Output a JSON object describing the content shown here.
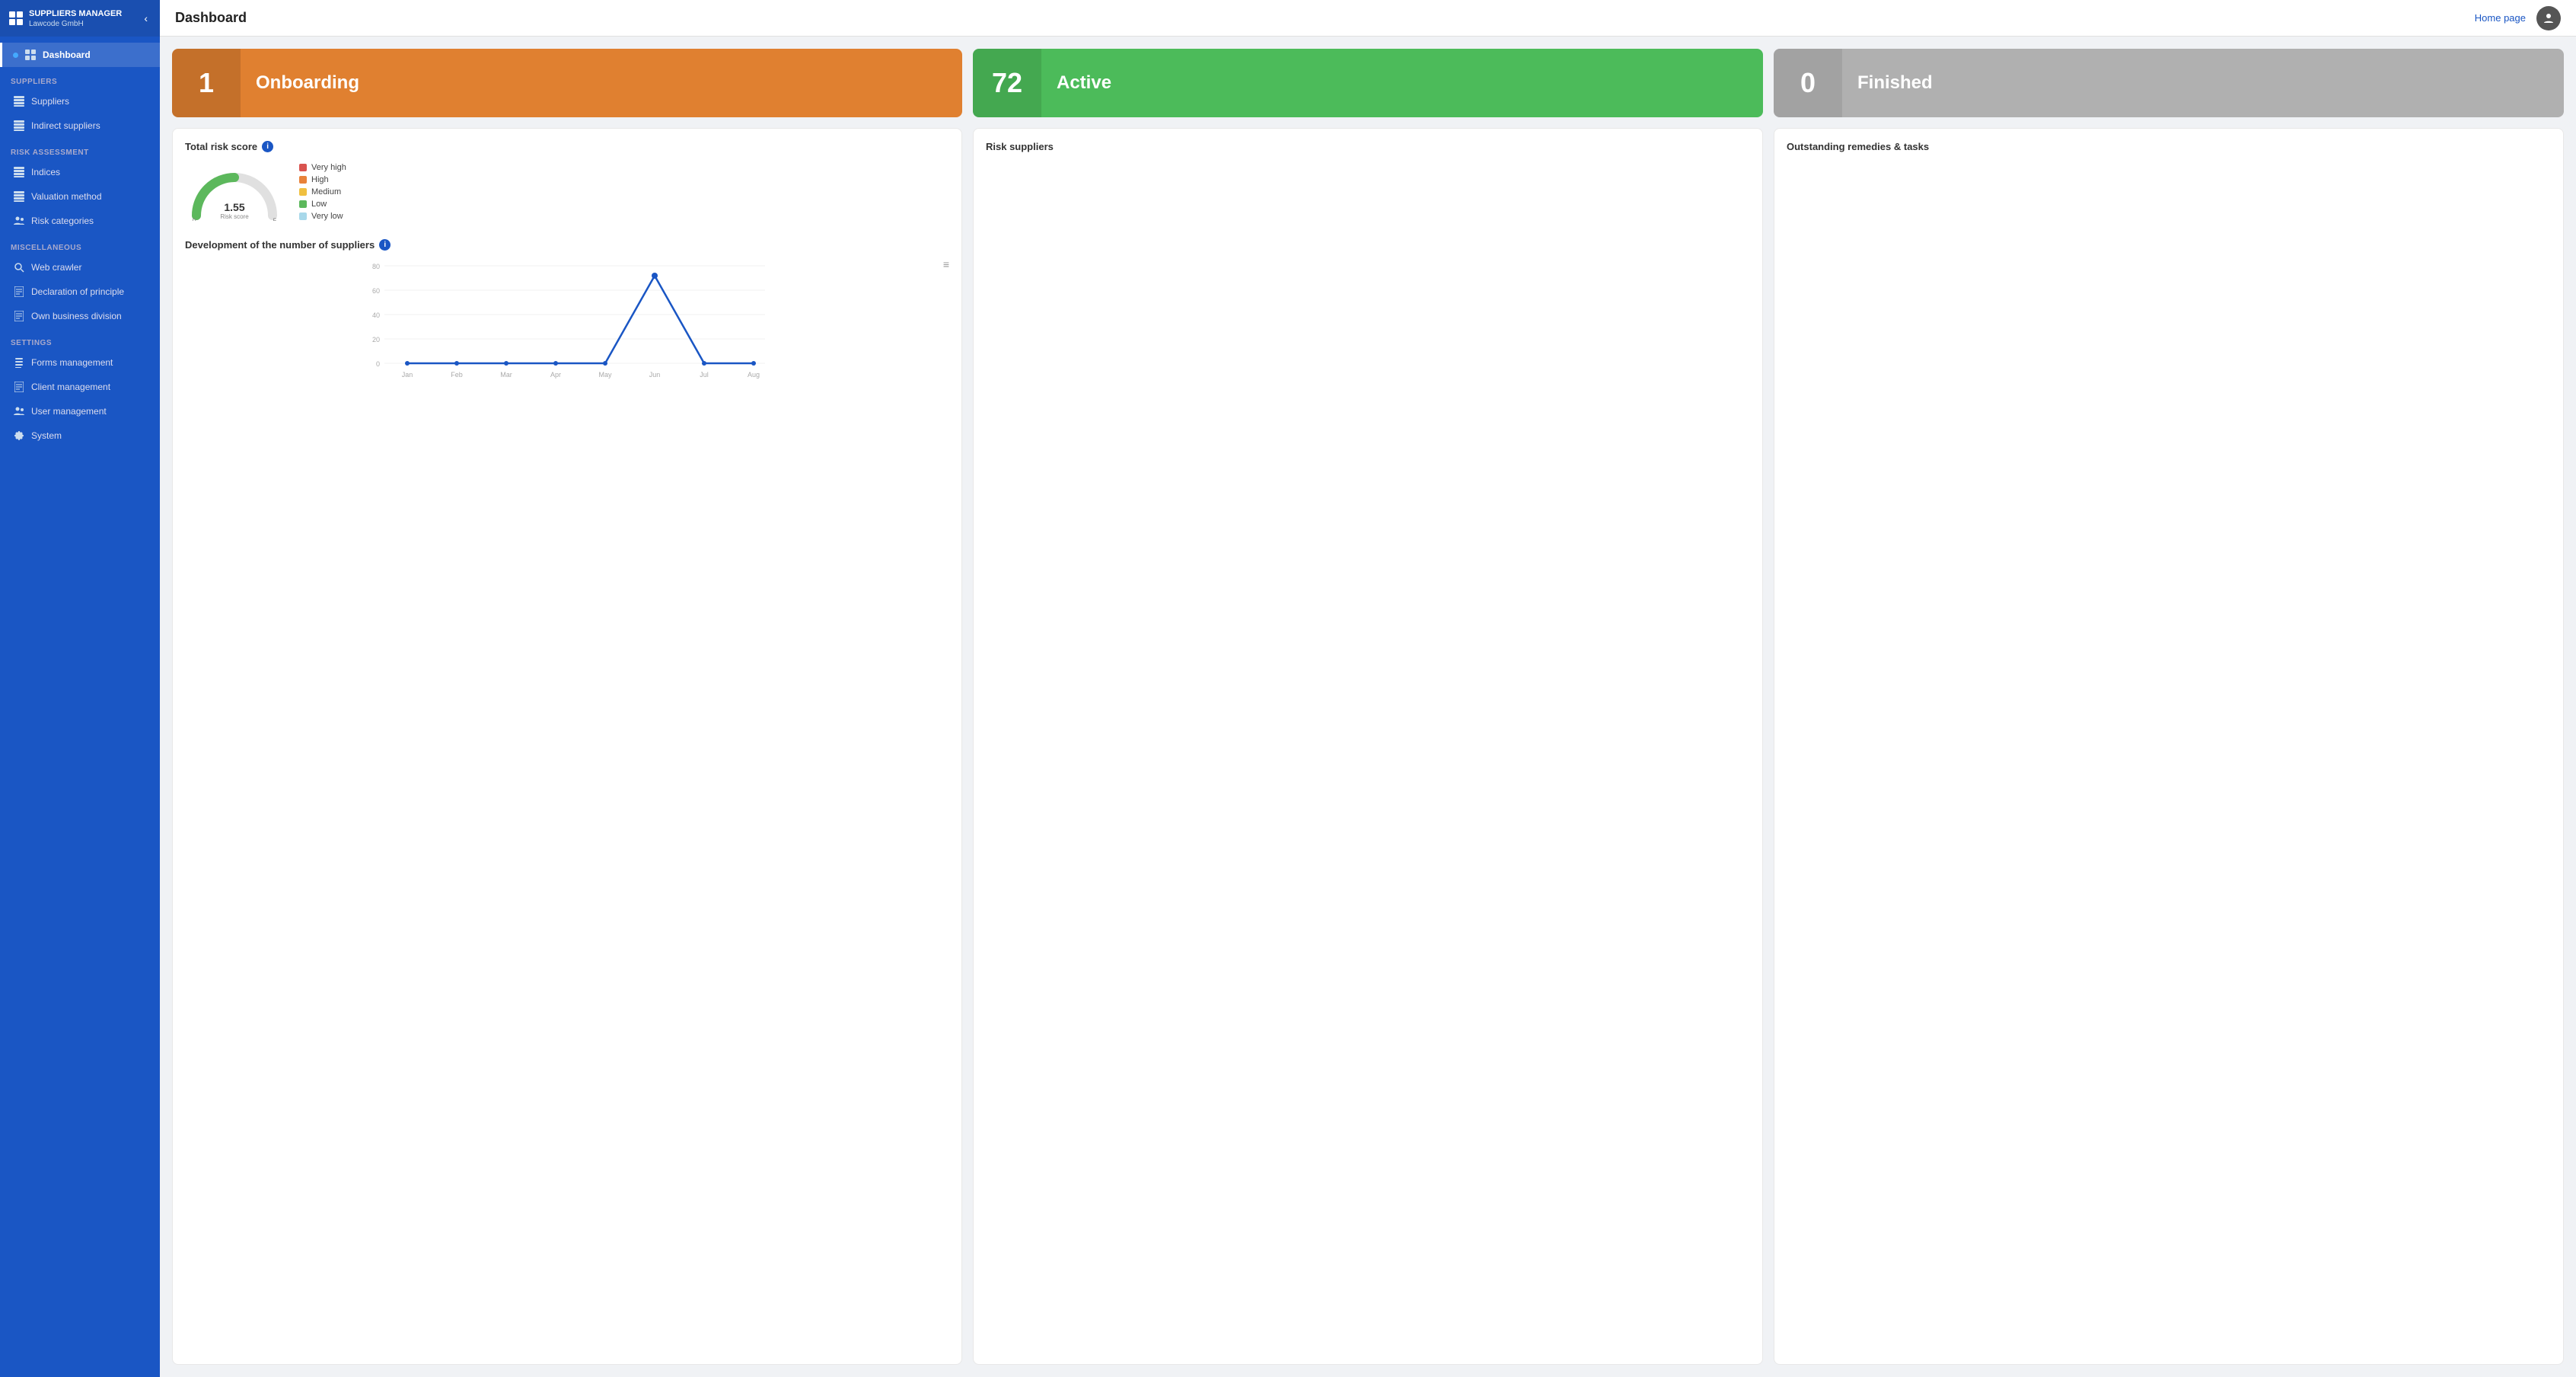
{
  "app": {
    "title": "SUPPLIERS MANAGER",
    "subtitle": "Lawcode GmbH",
    "home_page_link": "Home page",
    "page_title": "Dashboard"
  },
  "sidebar": {
    "sections": [
      {
        "label": "",
        "items": [
          {
            "id": "dashboard",
            "label": "Dashboard",
            "icon": "grid",
            "active": true,
            "dot": true
          }
        ]
      },
      {
        "label": "Suppliers",
        "items": [
          {
            "id": "suppliers",
            "label": "Suppliers",
            "icon": "table"
          },
          {
            "id": "indirect-suppliers",
            "label": "Indirect suppliers",
            "icon": "table"
          }
        ]
      },
      {
        "label": "Risk assessment",
        "items": [
          {
            "id": "indices",
            "label": "Indices",
            "icon": "table"
          },
          {
            "id": "valuation-method",
            "label": "Valuation method",
            "icon": "table"
          },
          {
            "id": "risk-categories",
            "label": "Risk categories",
            "icon": "people"
          }
        ]
      },
      {
        "label": "Miscellaneous",
        "items": [
          {
            "id": "web-crawler",
            "label": "Web crawler",
            "icon": "search"
          },
          {
            "id": "declaration-of-principle",
            "label": "Declaration of principle",
            "icon": "doc"
          },
          {
            "id": "own-business-division",
            "label": "Own business division",
            "icon": "doc"
          }
        ]
      },
      {
        "label": "Settings",
        "items": [
          {
            "id": "forms-management",
            "label": "Forms management",
            "icon": "list"
          },
          {
            "id": "client-management",
            "label": "Client management",
            "icon": "doc"
          },
          {
            "id": "user-management",
            "label": "User management",
            "icon": "people"
          },
          {
            "id": "system",
            "label": "System",
            "icon": "gear"
          }
        ]
      }
    ]
  },
  "status_cards": [
    {
      "id": "onboarding",
      "number": "1",
      "label": "Onboarding",
      "color_class": "card-onboarding"
    },
    {
      "id": "active",
      "number": "72",
      "label": "Active",
      "color_class": "card-active"
    },
    {
      "id": "finished",
      "number": "0",
      "label": "Finished",
      "color_class": "card-finished"
    }
  ],
  "risk_score": {
    "panel_title": "Total risk score",
    "value": "1.55",
    "sublabel": "Risk score",
    "min": "0",
    "max": "5",
    "legend": [
      {
        "label": "Very high",
        "color": "#d9534f"
      },
      {
        "label": "High",
        "color": "#e8823a"
      },
      {
        "label": "Medium",
        "color": "#f0c040"
      },
      {
        "label": "Low",
        "color": "#5cb85c"
      },
      {
        "label": "Very low",
        "color": "#a8d8ea"
      }
    ]
  },
  "risk_suppliers": {
    "panel_title": "Risk suppliers"
  },
  "outstanding_remedies": {
    "panel_title": "Outstanding remedies & tasks"
  },
  "supplier_development": {
    "panel_title": "Development of the number of suppliers",
    "x_labels": [
      "Jan",
      "Feb",
      "Mar",
      "Apr",
      "May",
      "Jun",
      "Jul",
      "Aug"
    ],
    "y_labels": [
      "0",
      "20",
      "40",
      "60",
      "80"
    ],
    "data_points": [
      0,
      0,
      0,
      0,
      0,
      72,
      0,
      0
    ]
  }
}
